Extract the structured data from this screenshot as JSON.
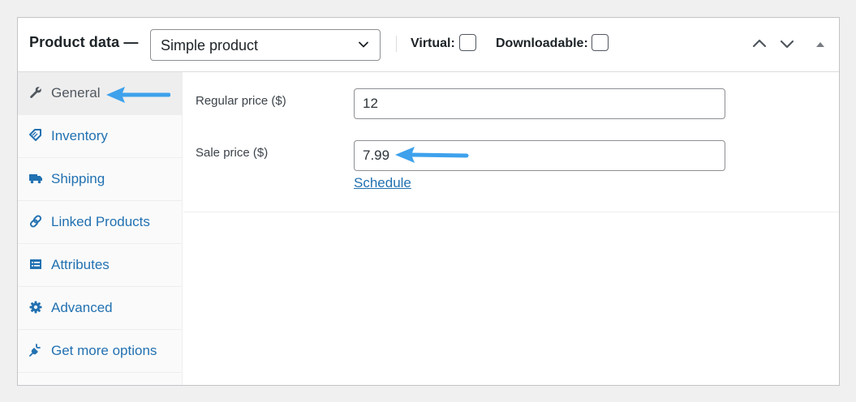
{
  "header": {
    "title": "Product data —",
    "product_type": {
      "selected": "Simple product"
    },
    "virtual_label": "Virtual:",
    "downloadable_label": "Downloadable:"
  },
  "tabs": [
    {
      "label": "General",
      "icon": "wrench-icon",
      "active": true
    },
    {
      "label": "Inventory",
      "icon": "tag-icon"
    },
    {
      "label": "Shipping",
      "icon": "truck-icon"
    },
    {
      "label": "Linked Products",
      "icon": "link-icon"
    },
    {
      "label": "Attributes",
      "icon": "list-icon"
    },
    {
      "label": "Advanced",
      "icon": "gear-icon"
    },
    {
      "label": "Get more options",
      "icon": "plugin-icon"
    }
  ],
  "general": {
    "regular_price_label": "Regular price ($)",
    "regular_price_value": "12",
    "sale_price_label": "Sale price ($)",
    "sale_price_value": "7.99",
    "schedule_link": "Schedule"
  },
  "colors": {
    "link": "#2271b1",
    "annotation_arrow": "#3ea1ec"
  }
}
